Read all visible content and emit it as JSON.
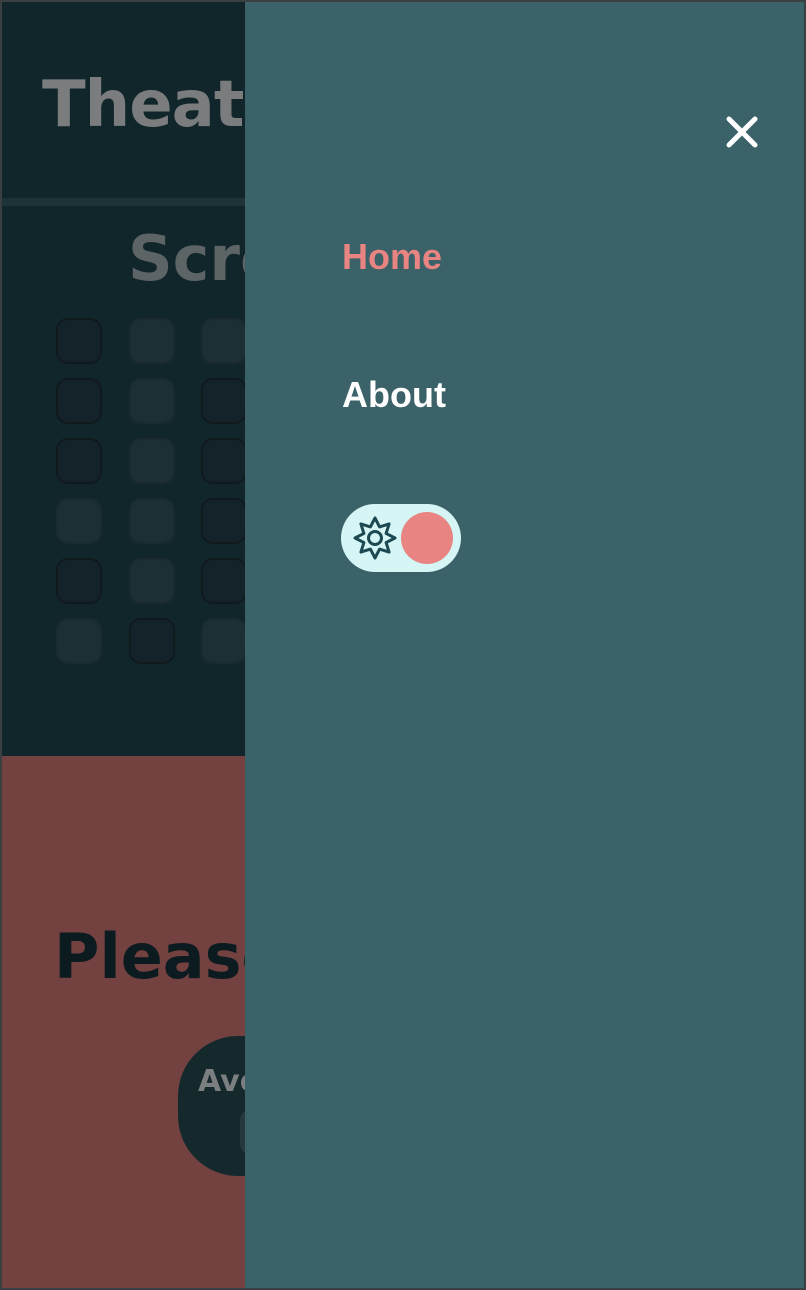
{
  "background_page": {
    "title": "Theatr",
    "screen_label": "Scre",
    "prompt": "Please",
    "pill_label": "Avo"
  },
  "drawer": {
    "close_icon": "close-icon",
    "nav": [
      {
        "label": "Home",
        "active": true
      },
      {
        "label": "About",
        "active": false
      }
    ],
    "theme_toggle": {
      "icon": "sun-icon",
      "state": "on"
    }
  },
  "colors": {
    "drawer_bg": "#3a6268",
    "accent": "#e88482",
    "toggle_track": "#d6f6f6",
    "page_dark": "#11262a",
    "page_red": "#744141"
  }
}
